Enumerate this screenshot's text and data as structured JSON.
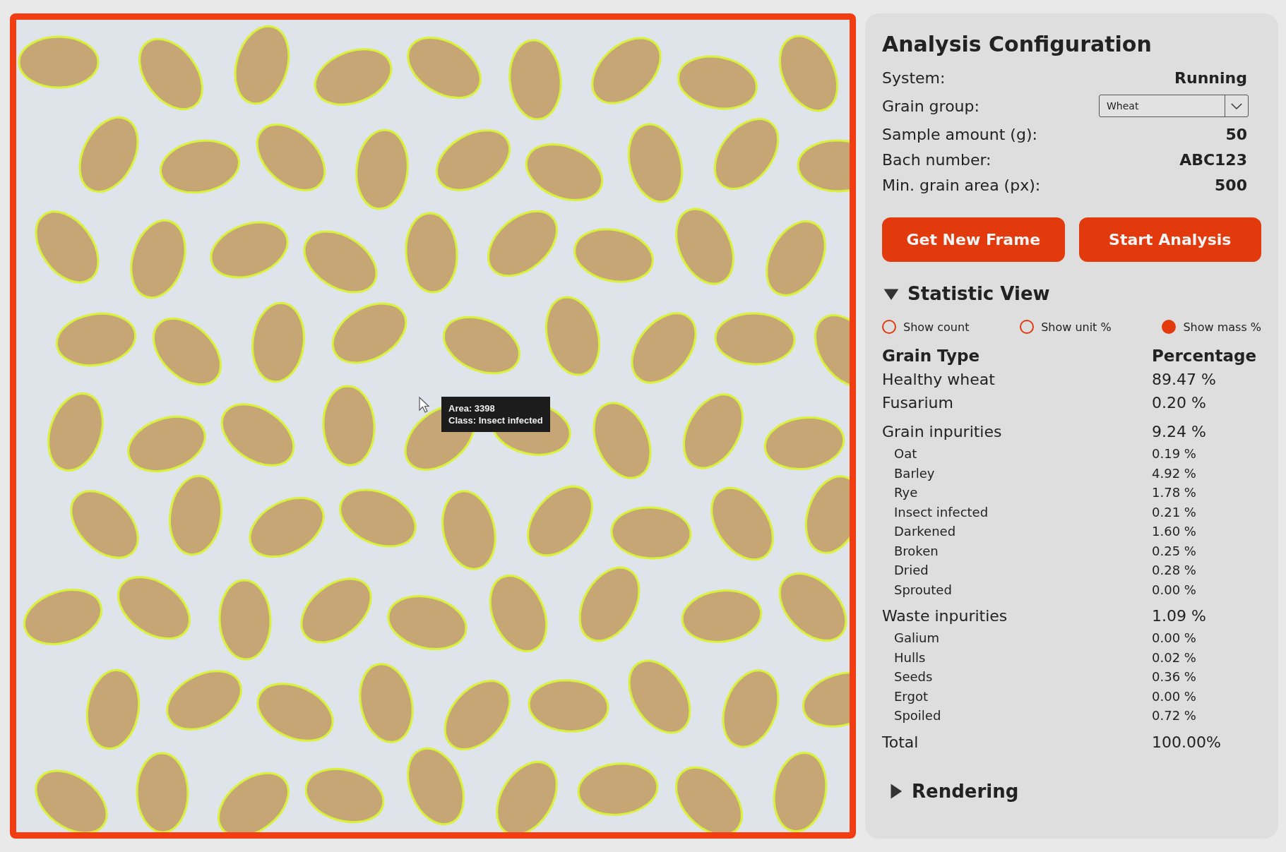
{
  "image_view": {
    "tooltip": {
      "lines": [
        "Area: 3398",
        "Class: Insect infected"
      ]
    }
  },
  "config": {
    "title": "Analysis Configuration",
    "fields": [
      {
        "kind": "text",
        "label": "System:",
        "value": "Running"
      },
      {
        "kind": "select",
        "label": "Grain group:",
        "value": "Wheat"
      },
      {
        "kind": "text",
        "label": "Sample amount (g):",
        "value": "50"
      },
      {
        "kind": "text",
        "label": "Bach number:",
        "value": "ABC123"
      },
      {
        "kind": "text",
        "label": "Min. grain area (px):",
        "value": "500"
      }
    ]
  },
  "buttons": [
    "Get New Frame",
    "Start Analysis"
  ],
  "statistic_view": {
    "title": "Statistic View",
    "expanded": true,
    "options": [
      {
        "label": "Show count",
        "selected": false
      },
      {
        "label": "Show unit %",
        "selected": false
      },
      {
        "label": "Show mass %",
        "selected": true
      }
    ],
    "columns": [
      "Grain Type",
      "Percentage"
    ],
    "rows": [
      {
        "name": "Healthy wheat",
        "value": "89.47 %"
      },
      {
        "name": "Fusarium",
        "value": "0.20 %"
      },
      {
        "name": "Grain inpurities",
        "value": "9.24 %",
        "children": [
          {
            "name": "Oat",
            "value": "0.19 %"
          },
          {
            "name": "Barley",
            "value": "4.92 %"
          },
          {
            "name": "Rye",
            "value": "1.78 %"
          },
          {
            "name": "Insect infected",
            "value": "0.21 %"
          },
          {
            "name": "Darkened",
            "value": "1.60 %"
          },
          {
            "name": "Broken",
            "value": "0.25 %"
          },
          {
            "name": "Dried",
            "value": "0.28 %"
          },
          {
            "name": "Sprouted",
            "value": "0.00 %"
          }
        ]
      },
      {
        "name": "Waste inpurities",
        "value": "1.09 %",
        "children": [
          {
            "name": "Galium",
            "value": "0.00 %"
          },
          {
            "name": "Hulls",
            "value": "0.02 %"
          },
          {
            "name": "Seeds",
            "value": "0.36 %"
          },
          {
            "name": "Ergot",
            "value": "0.00 %"
          },
          {
            "name": "Spoiled",
            "value": "0.72 %"
          }
        ]
      },
      {
        "name": "Total",
        "value": "100.00%"
      }
    ]
  },
  "rendering": {
    "title": "Rendering",
    "expanded": false
  }
}
